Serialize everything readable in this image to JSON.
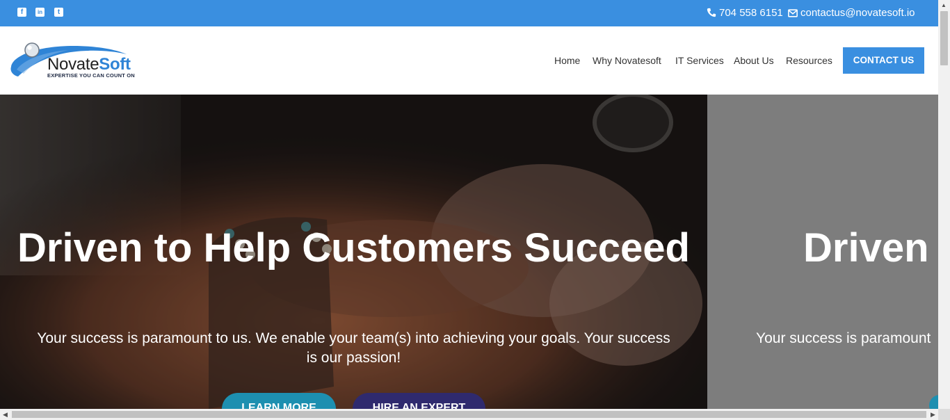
{
  "topbar": {
    "social": [
      {
        "icon": "facebook-icon",
        "glyph": "f"
      },
      {
        "icon": "linkedin-icon",
        "glyph": "in"
      },
      {
        "icon": "twitter-icon",
        "glyph": "t"
      }
    ],
    "phone": "704 558 6151",
    "email": "contactus@novatesoft.io",
    "bar_color": "#3a8fe0"
  },
  "header": {
    "logo": {
      "name_part1": "Novate",
      "name_part2": "Soft",
      "tagline": "EXPERTISE YOU CAN COUNT ON"
    },
    "nav": [
      "Home",
      "Why Novatesoft",
      "IT Services",
      "About Us",
      "Resources"
    ],
    "cta_label": "CONTACT US"
  },
  "hero": {
    "title": "Driven to Help Customers Succeed",
    "subtitle": "Your success is paramount to us. We enable your team(s) into achieving your goals. Your success is our passion!",
    "buttons": [
      "LEARN MORE",
      "HIRE AN EXPERT"
    ]
  },
  "next_slide": {
    "title": "Driven",
    "subtitle": "Your success is paramount"
  },
  "colors": {
    "accent": "#3a8fe0",
    "learn_button": "#1d8fb0",
    "hire_button": "#2f2a6e"
  }
}
